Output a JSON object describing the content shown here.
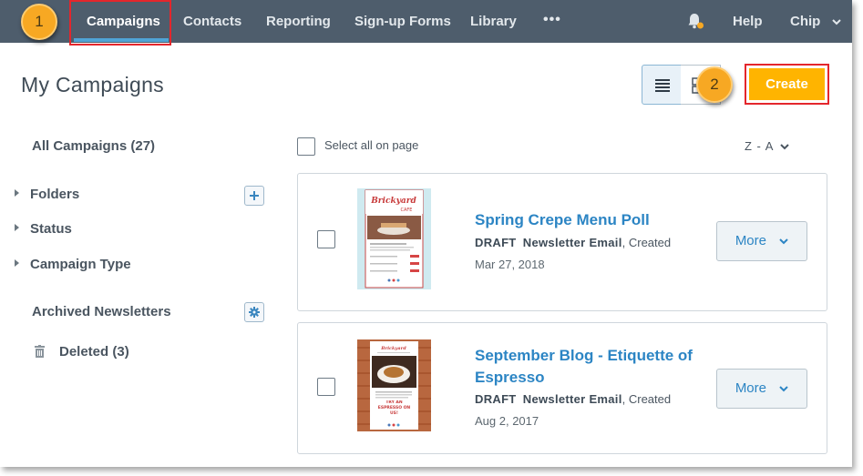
{
  "nav": {
    "items": [
      "Campaigns",
      "Contacts",
      "Reporting",
      "Sign-up Forms",
      "Library"
    ],
    "more": "•••",
    "help": "Help",
    "user": "Chip"
  },
  "callouts": [
    "1",
    "2"
  ],
  "header": {
    "title": "My Campaigns",
    "create_label": "Create"
  },
  "sidebar": {
    "all_campaigns": "All Campaigns (27)",
    "folders": "Folders",
    "status": "Status",
    "campaign_type": "Campaign Type",
    "archived": "Archived Newsletters",
    "deleted": "Deleted (3)"
  },
  "list": {
    "select_all": "Select all on page",
    "sort": "Z - A",
    "campaigns": [
      {
        "title_lines": [
          "Spring Crepe Menu Poll"
        ],
        "status": "DRAFT",
        "type": "Newsletter Email",
        "suffix": ", Created",
        "date": "Mar 27, 2018",
        "more": "More"
      },
      {
        "title_lines": [
          "September Blog - Etiquette of",
          "Espresso"
        ],
        "status": "DRAFT",
        "type": "Newsletter Email",
        "suffix": ", Created",
        "date": "Aug 2, 2017",
        "more": "More"
      }
    ]
  },
  "thumbs": {
    "brand": "Brickyard",
    "brand_sub": "CAFE",
    "promo": "TRY AN ESPRESSO ON US!"
  },
  "colors": {
    "nav_bg": "#4e5d6c",
    "accent": "#2c85c4",
    "create": "#ffb400",
    "callout": "#f7a823",
    "highlight": "#e4262c"
  }
}
